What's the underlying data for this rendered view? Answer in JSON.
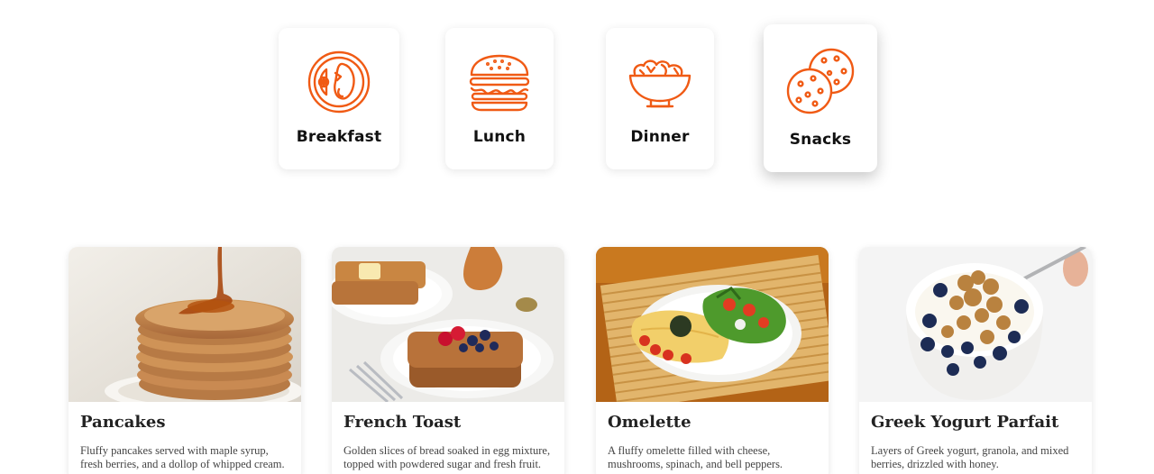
{
  "accent_color": "#f05a14",
  "categories": [
    {
      "label": "Breakfast",
      "icon": "breakfast-plate-icon"
    },
    {
      "label": "Lunch",
      "icon": "burger-icon"
    },
    {
      "label": "Dinner",
      "icon": "salad-bowl-icon"
    },
    {
      "label": "Snacks",
      "icon": "cookies-icon",
      "selected": true
    }
  ],
  "recipes": [
    {
      "title": "Pancakes",
      "description": "Fluffy pancakes served with maple syrup, fresh berries, and a dollop of whipped cream."
    },
    {
      "title": "French Toast",
      "description": "Golden slices of bread soaked in egg mixture, topped with powdered sugar and fresh fruit."
    },
    {
      "title": "Omelette",
      "description": "A fluffy omelette filled with cheese, mushrooms, spinach, and bell peppers."
    },
    {
      "title": "Greek Yogurt Parfait",
      "description": "Layers of Greek yogurt, granola, and mixed berries, drizzled with honey."
    }
  ]
}
